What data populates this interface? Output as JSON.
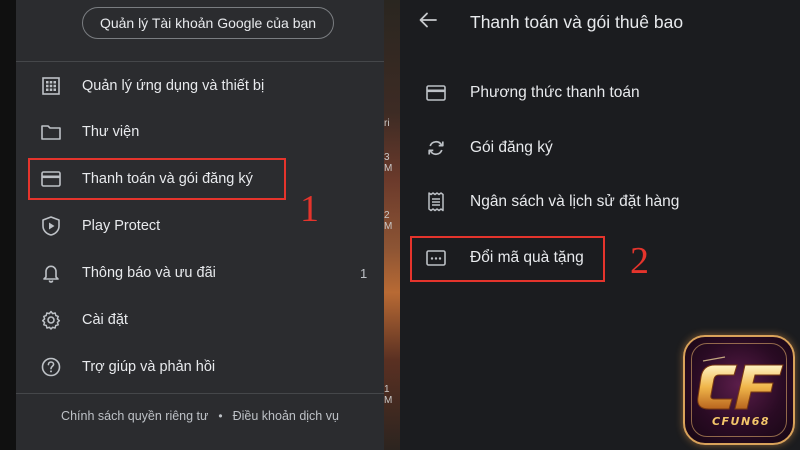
{
  "left": {
    "manage_account_button": "Quản lý Tài khoản Google của bạn",
    "menu": [
      {
        "label": "Quản lý ứng dụng và thiết bị",
        "icon": "grid-icon"
      },
      {
        "label": "Thư viện",
        "icon": "folder-icon"
      },
      {
        "label": "Thanh toán và gói đăng ký",
        "icon": "card-icon"
      },
      {
        "label": "Play Protect",
        "icon": "shield-play-icon"
      },
      {
        "label": "Thông báo và ưu đãi",
        "icon": "bell-icon",
        "count": "1"
      },
      {
        "label": "Cài đặt",
        "icon": "gear-icon"
      },
      {
        "label": "Trợ giúp và phản hồi",
        "icon": "help-icon"
      }
    ],
    "footer": {
      "privacy": "Chính sách quyền riêng tư",
      "separator": "•",
      "terms": "Điều khoản dịch vụ"
    },
    "step_number": "1",
    "background_ticks": [
      "ri",
      "3 M",
      "2 M",
      "1 M"
    ]
  },
  "right": {
    "title": "Thanh toán và gói thuê bao",
    "menu": [
      {
        "label": "Phương thức thanh toán",
        "icon": "card-icon"
      },
      {
        "label": "Gói đăng ký",
        "icon": "sync-icon"
      },
      {
        "label": "Ngân sách và lịch sử đặt hàng",
        "icon": "receipt-icon"
      },
      {
        "label": "Đổi mã quà tặng",
        "icon": "gift-code-icon"
      }
    ],
    "step_number": "2"
  },
  "logo": {
    "wordmark": "CF",
    "caption": "CFUN68"
  },
  "colors": {
    "highlight": "#e5342c",
    "left_panel_bg": "#2b2c2f",
    "right_panel_bg": "#1b1c1f",
    "text": "#e8eaed"
  }
}
